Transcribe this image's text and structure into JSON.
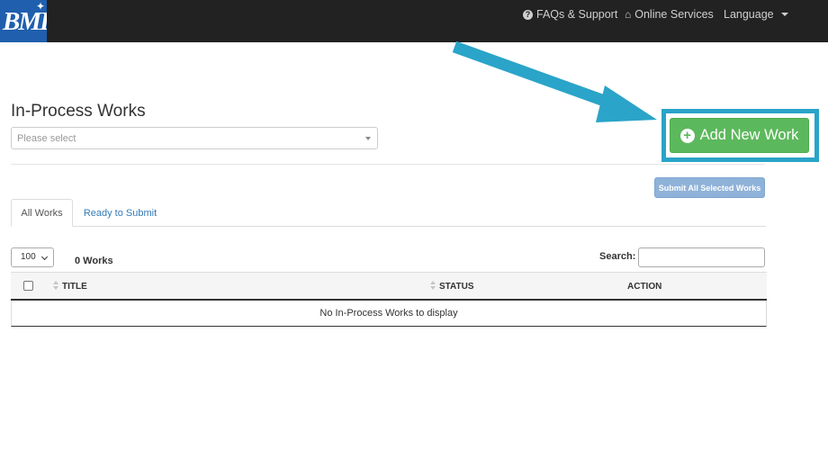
{
  "navbar": {
    "logo_text": "BMI",
    "faq_label": "FAQs & Support",
    "online_services_label": "Online Services",
    "language_label": "Language"
  },
  "page": {
    "title": "In-Process Works",
    "select_placeholder": "Please select",
    "add_new_work_label": "Add New Work",
    "submit_all_label": "Submit All Selected Works"
  },
  "tabs": [
    {
      "label": "All Works",
      "active": true
    },
    {
      "label": "Ready to Submit",
      "active": false
    }
  ],
  "controls": {
    "page_length": "100",
    "works_count": "0 Works",
    "search_label": "Search:",
    "search_value": ""
  },
  "table": {
    "columns": [
      "TITLE",
      "STATUS",
      "ACTION"
    ],
    "empty_message": "No In-Process Works to display"
  },
  "colors": {
    "navbar_bg": "#222222",
    "logo_bg": "#1f5fae",
    "add_button": "#5cb85c",
    "highlight_border": "#2aa4c8",
    "arrow": "#2aa4c8",
    "submit_all_button": "#8fb2d9",
    "link": "#337ab7"
  },
  "icons": {
    "faq": "question-circle-icon",
    "online_services": "home-icon",
    "language": "caret-down-icon",
    "add": "plus-circle-icon",
    "annotation": "arrow-icon"
  }
}
